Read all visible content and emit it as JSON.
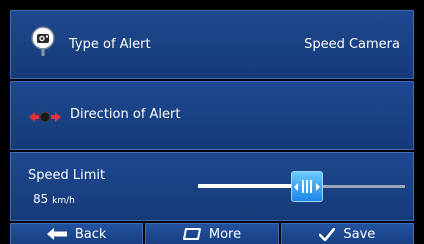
{
  "rows": {
    "type_of_alert": {
      "label": "Type of Alert",
      "value": "Speed Camera",
      "icon": "speed-camera-icon"
    },
    "direction_of_alert": {
      "label": "Direction of Alert",
      "icon": "direction-arrows-icon"
    },
    "speed_limit": {
      "label": "Speed Limit",
      "value": "85",
      "unit": "km/h",
      "slider_fraction": 0.5
    }
  },
  "bottom_bar": {
    "back_label": "Back",
    "more_label": "More",
    "save_label": "Save"
  },
  "colors": {
    "panel": "#1e4890",
    "accent": "#1d86e8",
    "direction_red": "#e0303a"
  }
}
